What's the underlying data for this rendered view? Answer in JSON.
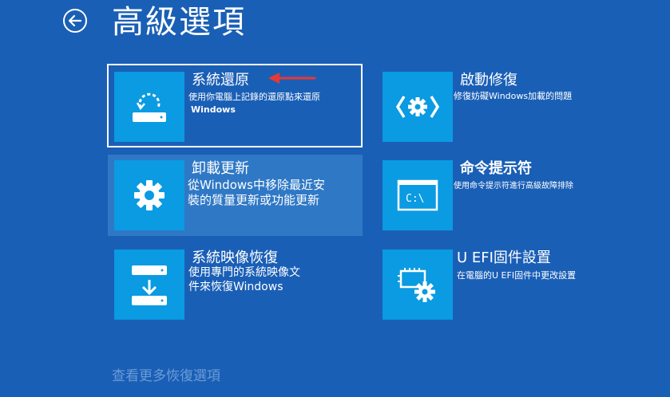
{
  "header": {
    "title": "高級選項",
    "back_icon": "back-arrow-icon"
  },
  "tiles": [
    {
      "title": "系統還原",
      "desc1": "使用你電腦上記錄的還原點來還原",
      "desc2": "Windows",
      "icon": "system-restore-icon"
    },
    {
      "title": "卸載更新",
      "desc1": "從Windows中移除最近安",
      "desc2": "裝的質量更新或功能更新",
      "icon": "gear-icon"
    },
    {
      "title": "系統映像恢復",
      "desc1": "使用專門的系統映像文",
      "desc2": "件來恢復Windows",
      "icon": "system-image-icon"
    },
    {
      "title": "啟動修復",
      "desc1": "修復妨礙Windows加載的問題",
      "icon": "startup-repair-icon"
    },
    {
      "title": "命令提示符",
      "desc1": "使用命令提示符進行高級故障排除",
      "icon": "command-prompt-icon",
      "prompt_text": "C:\\"
    },
    {
      "title": "U EFI固件設置",
      "desc1": "在電腦的U EFI固件中更改設置",
      "icon": "uefi-settings-icon"
    }
  ],
  "footer": {
    "more_link": "查看更多恢復選項"
  },
  "annotation": {
    "icon": "red-arrow-icon",
    "color": "#e53935"
  },
  "colors": {
    "background": "#1a5fb6",
    "tile": "#0a9be2",
    "hover": "#2f78c6"
  }
}
